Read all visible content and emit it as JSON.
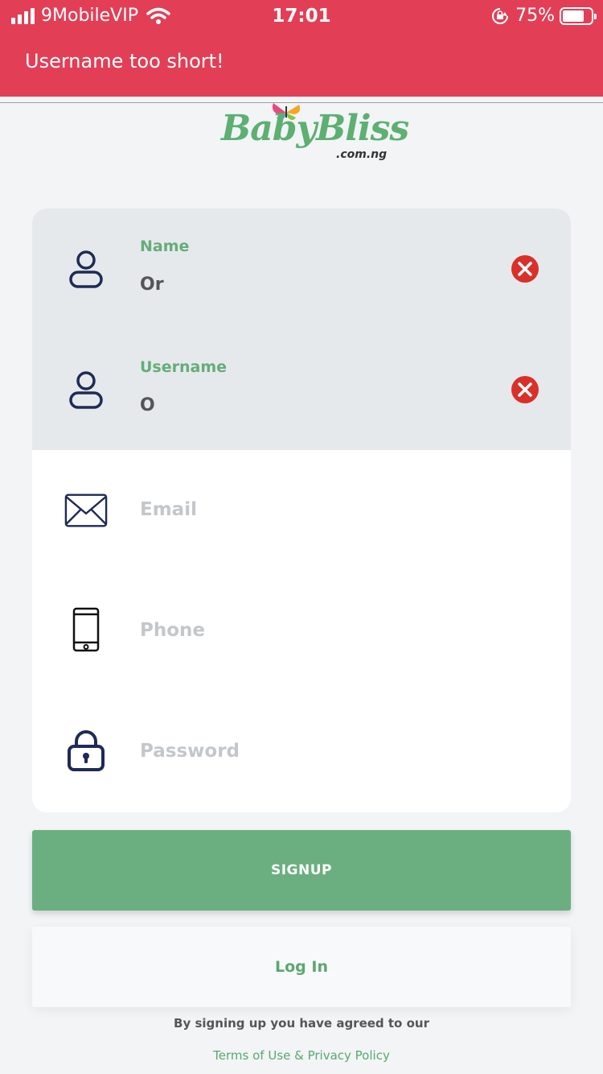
{
  "status_bar": {
    "carrier": "9MobileVIP",
    "time": "17:01",
    "battery_percent": "75%",
    "battery_level": 0.75,
    "icons": [
      "signal-icon",
      "wifi-icon",
      "rotation-lock-icon",
      "battery-icon"
    ]
  },
  "banner": {
    "message": "Username too short!",
    "color": "#e23f56"
  },
  "logo": {
    "text": "BabyBliss",
    "sub": ".com.ng"
  },
  "form": {
    "fields": [
      {
        "label": "Name",
        "value": "Or",
        "icon": "user-icon",
        "state": "error"
      },
      {
        "label": "Username",
        "value": "O",
        "icon": "user-icon",
        "state": "error"
      },
      {
        "placeholder": "Email",
        "icon": "envelope-icon"
      },
      {
        "placeholder": "Phone",
        "icon": "smartphone-icon"
      },
      {
        "placeholder": "Password",
        "icon": "lock-icon"
      }
    ]
  },
  "buttons": {
    "signup": "SIGNUP",
    "login": "Log In"
  },
  "footer": {
    "agree_text": "By signing up you have agreed to our",
    "terms_link": "Terms of Use & Privacy Policy"
  },
  "colors": {
    "accent_green": "#6baf80",
    "error_red": "#e23f56",
    "icon_navy": "#1f2a55"
  }
}
